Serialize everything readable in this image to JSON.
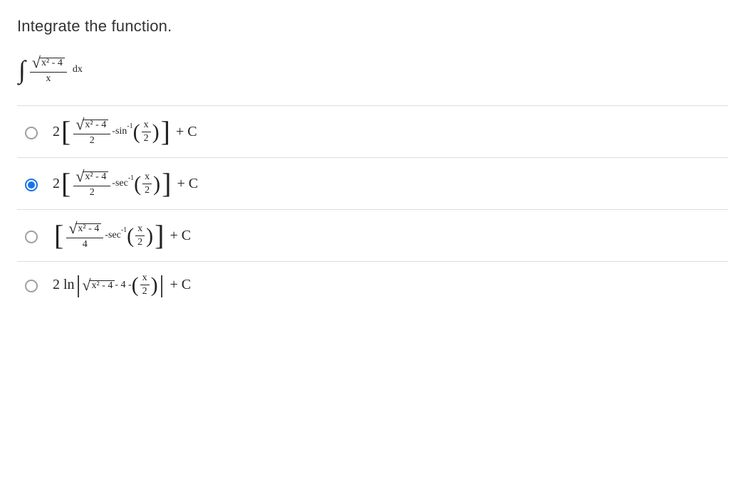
{
  "question": {
    "prompt": "Integrate the function."
  },
  "integral": {
    "symbol": "∫",
    "numerator_radicand": "x² - 4",
    "denominator": "x",
    "dx": "dx"
  },
  "common": {
    "radicand": "x² - 4",
    "xover2_num": "x",
    "xover2_den": "2",
    "plusC": "+ C"
  },
  "options": {
    "a": {
      "lead": "2",
      "frac_den": "2",
      "trig": "sin",
      "inv": "-1",
      "minus": " - "
    },
    "b": {
      "lead": "2",
      "frac_den": "2",
      "trig": "sec",
      "inv": "-1",
      "minus": " - "
    },
    "c": {
      "frac_den": "4",
      "trig": "sec",
      "inv": "-1",
      "minus": " - "
    },
    "d": {
      "lead": "2 ln",
      "minus4": " - 4 - "
    }
  },
  "selected": "b"
}
